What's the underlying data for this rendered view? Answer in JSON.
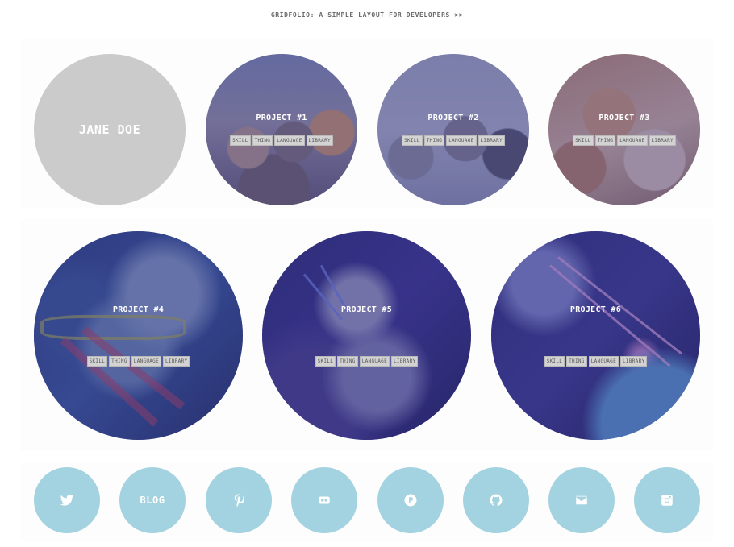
{
  "header": {
    "link_text": "GRIDFOLIO: A SIMPLE LAYOUT FOR DEVELOPERS >>"
  },
  "profile": {
    "name": "JANE DOE",
    "bg_color": "#cbcbcb"
  },
  "projects": [
    {
      "title": "PROJECT #1",
      "tags": [
        "SKILL",
        "THING",
        "LANGUAGE",
        "LIBRARY"
      ]
    },
    {
      "title": "PROJECT #2",
      "tags": [
        "SKILL",
        "THING",
        "LANGUAGE",
        "LIBRARY"
      ]
    },
    {
      "title": "PROJECT #3",
      "tags": [
        "SKILL",
        "THING",
        "LANGUAGE",
        "LIBRARY"
      ]
    },
    {
      "title": "PROJECT #4",
      "tags": [
        "SKILL",
        "THING",
        "LANGUAGE",
        "LIBRARY"
      ]
    },
    {
      "title": "PROJECT #5",
      "tags": [
        "SKILL",
        "THING",
        "LANGUAGE",
        "LIBRARY"
      ]
    },
    {
      "title": "PROJECT #6",
      "tags": [
        "SKILL",
        "THING",
        "LANGUAGE",
        "LIBRARY"
      ]
    }
  ],
  "social": {
    "color": "#a3d2e0",
    "items": [
      {
        "icon": "twitter-icon"
      },
      {
        "label": "BLOG"
      },
      {
        "icon": "pinterest-icon"
      },
      {
        "icon": "flickr-icon"
      },
      {
        "icon": "producthunt-icon"
      },
      {
        "icon": "github-icon"
      },
      {
        "icon": "email-icon"
      },
      {
        "icon": "instagram-icon"
      }
    ]
  }
}
